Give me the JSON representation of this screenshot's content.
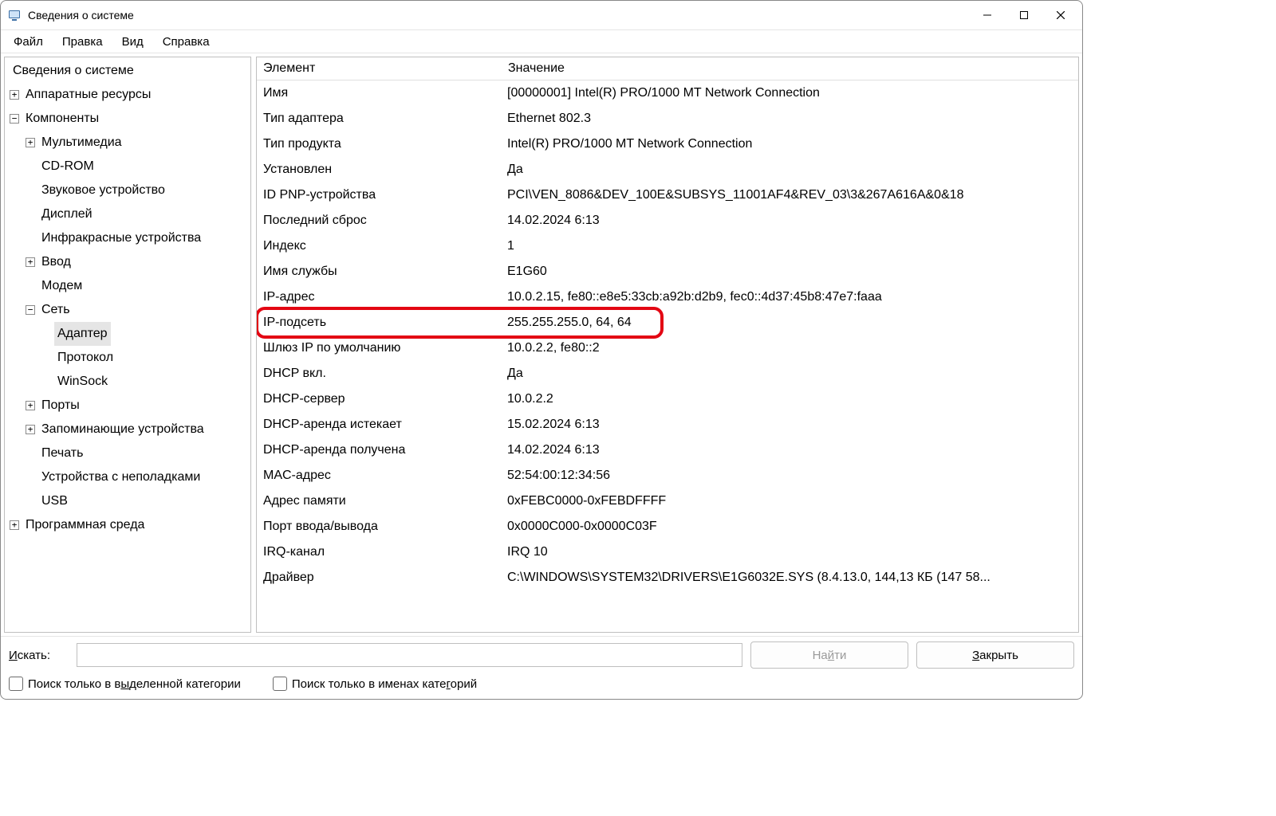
{
  "window": {
    "title": "Сведения о системе"
  },
  "menu": {
    "file": "Файл",
    "edit": "Правка",
    "view": "Вид",
    "help": "Справка"
  },
  "tree": {
    "root": "Сведения о системе",
    "hardware": "Аппаратные ресурсы",
    "components": "Компоненты",
    "multimedia": "Мультимедиа",
    "cdrom": "CD-ROM",
    "sound": "Звуковое устройство",
    "display": "Дисплей",
    "infrared": "Инфракрасные устройства",
    "input": "Ввод",
    "modem": "Модем",
    "network": "Сеть",
    "adapter": "Адаптер",
    "protocol": "Протокол",
    "winsock": "WinSock",
    "ports": "Порты",
    "storage": "Запоминающие устройства",
    "print": "Печать",
    "problem": "Устройства с неполадками",
    "usb": "USB",
    "software": "Программная среда"
  },
  "columns": {
    "element": "Элемент",
    "value": "Значение"
  },
  "details": [
    {
      "k": "Имя",
      "v": "[00000001] Intel(R) PRO/1000 MT Network Connection"
    },
    {
      "k": "Тип адаптера",
      "v": "Ethernet 802.3"
    },
    {
      "k": "Тип продукта",
      "v": "Intel(R) PRO/1000 MT Network Connection"
    },
    {
      "k": "Установлен",
      "v": "Да"
    },
    {
      "k": "ID PNP-устройства",
      "v": "PCI\\VEN_8086&DEV_100E&SUBSYS_11001AF4&REV_03\\3&267A616A&0&18"
    },
    {
      "k": "Последний сброс",
      "v": "14.02.2024 6:13"
    },
    {
      "k": "Индекс",
      "v": "1"
    },
    {
      "k": "Имя службы",
      "v": "E1G60"
    },
    {
      "k": "IP-адрес",
      "v": "10.0.2.15, fe80::e8e5:33cb:a92b:d2b9, fec0::4d37:45b8:47e7:faaa"
    },
    {
      "k": "IP-подсеть",
      "v": "255.255.255.0, 64, 64",
      "highlight": true
    },
    {
      "k": "Шлюз IP по умолчанию",
      "v": "10.0.2.2, fe80::2"
    },
    {
      "k": "DHCP вкл.",
      "v": "Да"
    },
    {
      "k": "DHCP-сервер",
      "v": "10.0.2.2"
    },
    {
      "k": "DHCP-аренда истекает",
      "v": "15.02.2024 6:13"
    },
    {
      "k": "DHCP-аренда получена",
      "v": "14.02.2024 6:13"
    },
    {
      "k": "MAC-адрес",
      "v": "52:54:00:12:34:56"
    },
    {
      "k": "Адрес памяти",
      "v": "0xFEBC0000-0xFEBDFFFF"
    },
    {
      "k": "Порт ввода/вывода",
      "v": "0x0000C000-0x0000C03F"
    },
    {
      "k": "IRQ-канал",
      "v": "IRQ 10"
    },
    {
      "k": "Драйвер",
      "v": "C:\\WINDOWS\\SYSTEM32\\DRIVERS\\E1G6032E.SYS (8.4.13.0, 144,13 КБ (147 58..."
    }
  ],
  "search": {
    "label_pre": "Искать:",
    "label_mn": "И",
    "find_pre": "На",
    "find_mn": "й",
    "find_post": "ти",
    "close_pre": "",
    "close_mn": "З",
    "close_post": "акрыть",
    "cb1_pre": "Поиск только в в",
    "cb1_mn": "ы",
    "cb1_post": "деленной категории",
    "cb2_pre": "Поиск только в именах кате",
    "cb2_mn": "г",
    "cb2_post": "орий"
  }
}
